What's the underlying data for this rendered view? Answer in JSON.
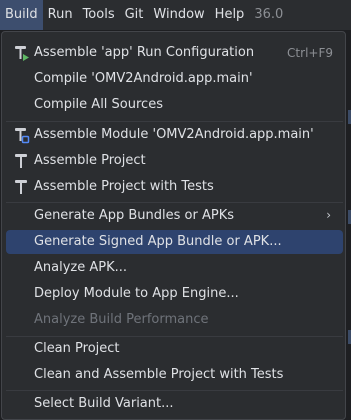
{
  "menubar": {
    "items": [
      {
        "label": "Build",
        "active": true
      },
      {
        "label": "Run"
      },
      {
        "label": "Tools"
      },
      {
        "label": "Git"
      },
      {
        "label": "Window"
      },
      {
        "label": "Help"
      },
      {
        "label": "36.0"
      }
    ]
  },
  "menu": {
    "assemble_app_run_config": {
      "label": "Assemble 'app' Run Configuration",
      "shortcut": "Ctrl+F9"
    },
    "compile_module": {
      "label": "Compile 'OMV2Android.app.main'"
    },
    "compile_all_sources": {
      "label": "Compile All Sources"
    },
    "assemble_module": {
      "label": "Assemble Module 'OMV2Android.app.main'"
    },
    "assemble_project": {
      "label": "Assemble Project"
    },
    "assemble_project_tests": {
      "label": "Assemble Project with Tests"
    },
    "generate_bundles_apks": {
      "label": "Generate App Bundles or APKs"
    },
    "generate_signed": {
      "label": "Generate Signed App Bundle or APK..."
    },
    "analyze_apk": {
      "label": "Analyze APK..."
    },
    "deploy_module": {
      "label": "Deploy Module to App Engine..."
    },
    "analyze_build_perf": {
      "label": "Analyze Build Performance"
    },
    "clean_project": {
      "label": "Clean Project"
    },
    "clean_assemble": {
      "label": "Clean and Assemble Project with Tests"
    },
    "select_build_variant": {
      "label": "Select Build Variant..."
    }
  },
  "colors": {
    "selection": "#2e436e",
    "menubar_active": "#3d4e6e",
    "hammer_icon": "#ced0d6",
    "run_badge": "#5fb865",
    "module_badge": "#548af7"
  }
}
